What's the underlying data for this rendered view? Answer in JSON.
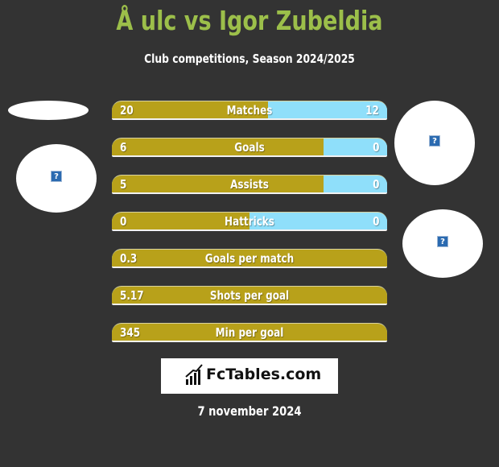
{
  "header": {
    "title": "Å ulc vs Igor Zubeldia",
    "subtitle": "Club competitions, Season 2024/2025"
  },
  "colors": {
    "background": "#333333",
    "title": "#9cbf4a",
    "left_bar": "#b8a11a",
    "right_bar": "#8fdffa"
  },
  "stats": [
    {
      "label": "Matches",
      "left": "20",
      "right": "12",
      "left_num": 20,
      "right_num": 12,
      "compare": true
    },
    {
      "label": "Goals",
      "left": "6",
      "right": "0",
      "left_num": 6,
      "right_num": 0,
      "compare": true
    },
    {
      "label": "Assists",
      "left": "5",
      "right": "0",
      "left_num": 5,
      "right_num": 0,
      "compare": true
    },
    {
      "label": "Hattricks",
      "left": "0",
      "right": "0",
      "left_num": 0,
      "right_num": 0,
      "compare": true
    },
    {
      "label": "Goals per match",
      "left": "0.3",
      "right": "",
      "compare": false
    },
    {
      "label": "Shots per goal",
      "left": "5.17",
      "right": "",
      "compare": false
    },
    {
      "label": "Min per goal",
      "left": "345",
      "right": "",
      "compare": false
    }
  ],
  "players": {
    "left": {
      "image_icon": "broken-image-icon",
      "glyph": "?"
    },
    "right": {
      "image_icon": "broken-image-icon",
      "glyph": "?"
    }
  },
  "footer": {
    "logo_text": "FcTables.com",
    "logo_icon": "bar-chart-icon",
    "date": "7 november 2024"
  }
}
